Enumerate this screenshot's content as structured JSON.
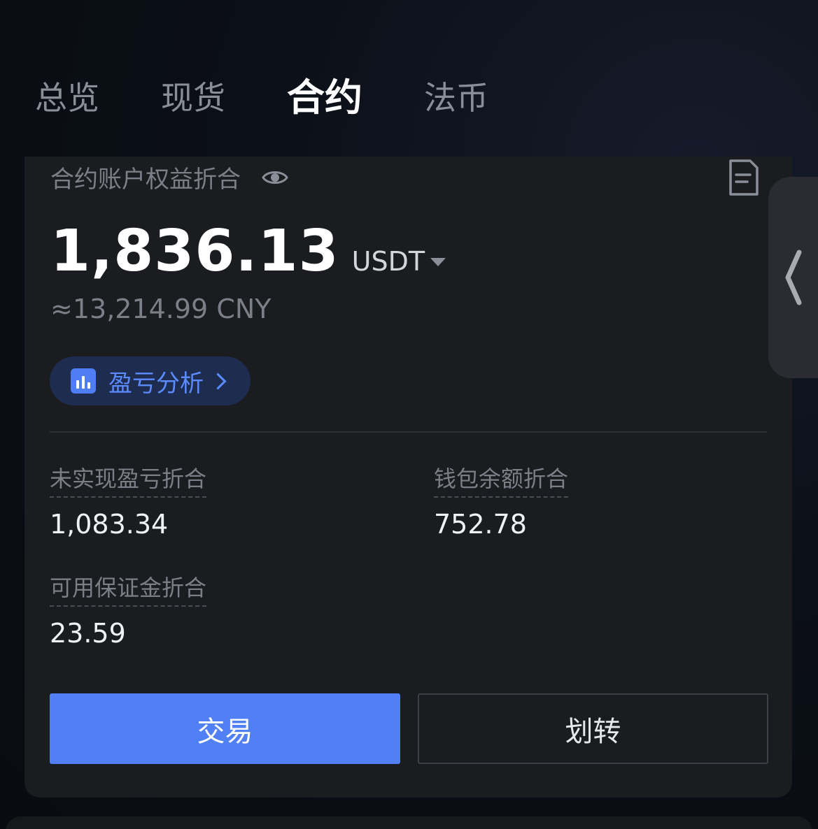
{
  "tabs": [
    {
      "label": "总览",
      "active": false
    },
    {
      "label": "现货",
      "active": false
    },
    {
      "label": "合约",
      "active": true
    },
    {
      "label": "法币",
      "active": false
    }
  ],
  "account": {
    "title": "合约账户权益折合",
    "balance": "1,836.13",
    "currency": "USDT",
    "fiat_equivalent": "≈13,214.99 CNY",
    "pnl_button_label": "盈亏分析"
  },
  "metrics": {
    "unrealized_pnl": {
      "label": "未实现盈亏折合",
      "value": "1,083.34"
    },
    "wallet_balance": {
      "label": "钱包余额折合",
      "value": "752.78"
    },
    "available_margin": {
      "label": "可用保证金折合",
      "value": "23.59"
    }
  },
  "actions": {
    "trade_label": "交易",
    "transfer_label": "划转"
  },
  "colors": {
    "accent": "#5080f4",
    "card_bg": "#1b1c20",
    "pnl_bg": "#1d2c4f"
  }
}
